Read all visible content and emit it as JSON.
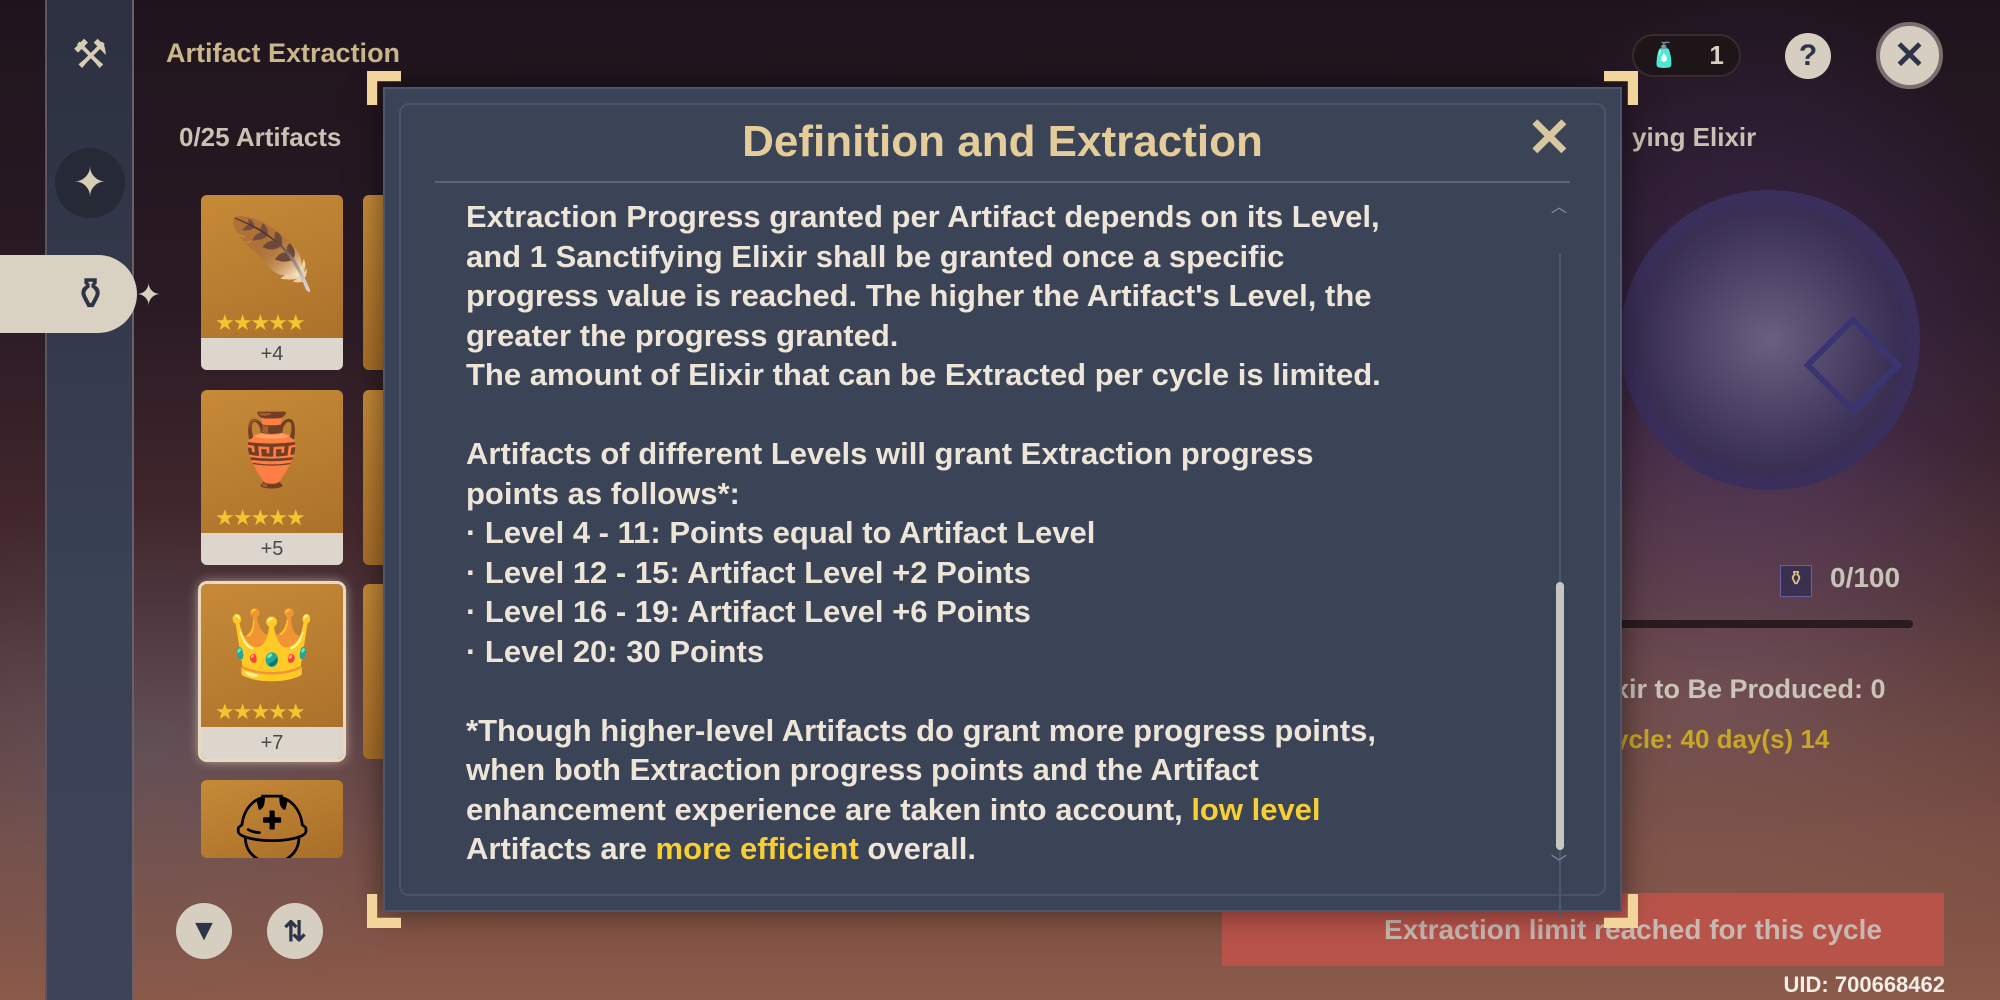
{
  "header": {
    "title": "Artifact Extraction",
    "artifact_count": "0/25 Artifacts",
    "currency_count": "1",
    "currency_icon": "elixir-icon",
    "help_label": "?",
    "close_label": "✕",
    "elixir_label": "ying Elixir"
  },
  "sidebar": {
    "items": [
      {
        "icon": "anvil-icon"
      },
      {
        "icon": "flower-orb-icon"
      },
      {
        "icon": "vase-icon",
        "active": true
      }
    ]
  },
  "artifacts": [
    {
      "level": "+4",
      "stars": "★★★★★",
      "art": "🪶"
    },
    {
      "level": "+5",
      "stars": "★★★★★",
      "art": "🏺"
    },
    {
      "level": "+7",
      "stars": "★★★★★",
      "art": "👑",
      "selected": true
    },
    {
      "level": "",
      "stars": "",
      "art": "⛑"
    }
  ],
  "toolbar": {
    "filter_icon": "filter-icon",
    "sort_icon": "sort-icon"
  },
  "right_panel": {
    "progress": "0/100",
    "progress_fraction": 0,
    "to_be_produced": "xir to Be Produced: 0",
    "cycle_line1": "ycle: 40 day(s) 14",
    "cycle_line2": ")",
    "limit_button": "Extraction limit reached for this cycle",
    "uid": "UID: 700668462"
  },
  "modal": {
    "title": "Definition and Extraction",
    "close": "✕",
    "lines": [
      "Extraction Progress granted per Artifact depends on its Level,",
      "and 1 Sanctifying Elixir shall be granted once a specific",
      "progress value is reached. The higher the Artifact's Level, the",
      "greater the progress granted.",
      "The amount of Elixir that can be Extracted per cycle is limited."
    ],
    "lines2": [
      "Artifacts of different Levels will grant Extraction progress",
      "points as follows*:",
      " · Level 4  -  11: Points equal to Artifact Level",
      " · Level 12  -  15: Artifact Level +2 Points",
      " · Level 16  -  19: Artifact Level +6 Points",
      " · Level 20: 30 Points"
    ],
    "note1": "*Though higher-level Artifacts do grant more progress points,",
    "note2": "when both Extraction progress points and the Artifact",
    "note3a": "enhancement experience are taken into account, ",
    "note3b": "low level",
    "note4a": "Artifacts are ",
    "note4b": "more efficient",
    "note4c": " overall.",
    "highlight_color": "#f7cf35"
  }
}
